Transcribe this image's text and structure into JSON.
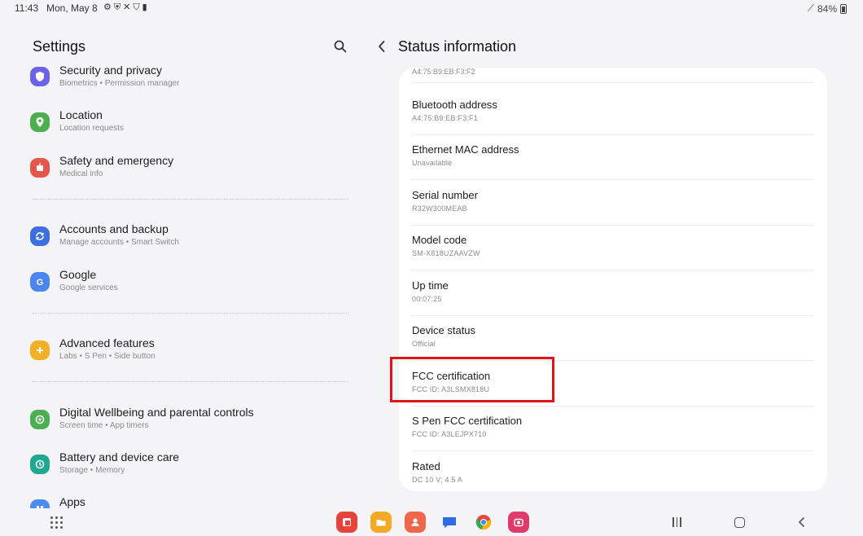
{
  "status_bar": {
    "time": "11:43",
    "date": "Mon, May 8",
    "icons": [
      "gear-icon",
      "shield-check-icon",
      "tools-icon",
      "shield-icon",
      "clipboard-icon"
    ],
    "battery": "84%"
  },
  "left_panel": {
    "title": "Settings",
    "items": [
      {
        "title": "Security and privacy",
        "subtitle": "Biometrics  •  Permission manager",
        "color": "#6a63e8",
        "icon": "shield-icon"
      },
      {
        "title": "Location",
        "subtitle": "Location requests",
        "color": "#4cae4f",
        "icon": "location-pin-icon"
      },
      {
        "title": "Safety and emergency",
        "subtitle": "Medical info",
        "color": "#e4574c",
        "icon": "alert-icon"
      },
      {
        "title": "Accounts and backup",
        "subtitle": "Manage accounts  •  Smart Switch",
        "color": "#3e6fe2",
        "icon": "sync-icon"
      },
      {
        "title": "Google",
        "subtitle": "Google services",
        "color": "#4c84f0",
        "icon": "google-icon"
      },
      {
        "title": "Advanced features",
        "subtitle": "Labs  •  S Pen  •  Side button",
        "color": "#f2b024",
        "icon": "plus-icon"
      },
      {
        "title": "Digital Wellbeing and parental controls",
        "subtitle": "Screen time  •  App timers",
        "color": "#4caf50",
        "icon": "wellbeing-icon"
      },
      {
        "title": "Battery and device care",
        "subtitle": "Storage  •  Memory",
        "color": "#1fa891",
        "icon": "device-care-icon"
      },
      {
        "title": "Apps",
        "subtitle": "",
        "color": "#4e8df0",
        "icon": "apps-icon"
      }
    ]
  },
  "right_panel": {
    "title": "Status information",
    "partial_value": "A4:75:B9:EB:F3:F2",
    "rows": [
      {
        "title": "Bluetooth address",
        "value": "A4:75:B9:EB:F3:F1"
      },
      {
        "title": "Ethernet MAC address",
        "value": "Unavailable"
      },
      {
        "title": "Serial number",
        "value": "R32W300MEAB"
      },
      {
        "title": "Model code",
        "value": "SM-X818UZAAVZW"
      },
      {
        "title": "Up time",
        "value": "00:07:25"
      },
      {
        "title": "Device status",
        "value": "Official"
      },
      {
        "title": "FCC certification",
        "value": "FCC ID: A3LSMX818U"
      },
      {
        "title": "S Pen FCC certification",
        "value": "FCC ID: A3LEJPX710"
      },
      {
        "title": "Rated",
        "value": "DC 10 V; 4.5 A"
      }
    ],
    "highlight_color": "#e0141c"
  },
  "dock": {
    "apps": [
      {
        "name": "samsung-notes-icon",
        "color": "#e8433a"
      },
      {
        "name": "my-files-icon",
        "color": "#f3a826"
      },
      {
        "name": "contacts-icon",
        "color": "#f0664a"
      },
      {
        "name": "messages-icon",
        "color": "#2e6be6"
      },
      {
        "name": "chrome-icon",
        "color": "#4285f4"
      },
      {
        "name": "camera-icon",
        "color": "#e03a6a"
      }
    ]
  }
}
